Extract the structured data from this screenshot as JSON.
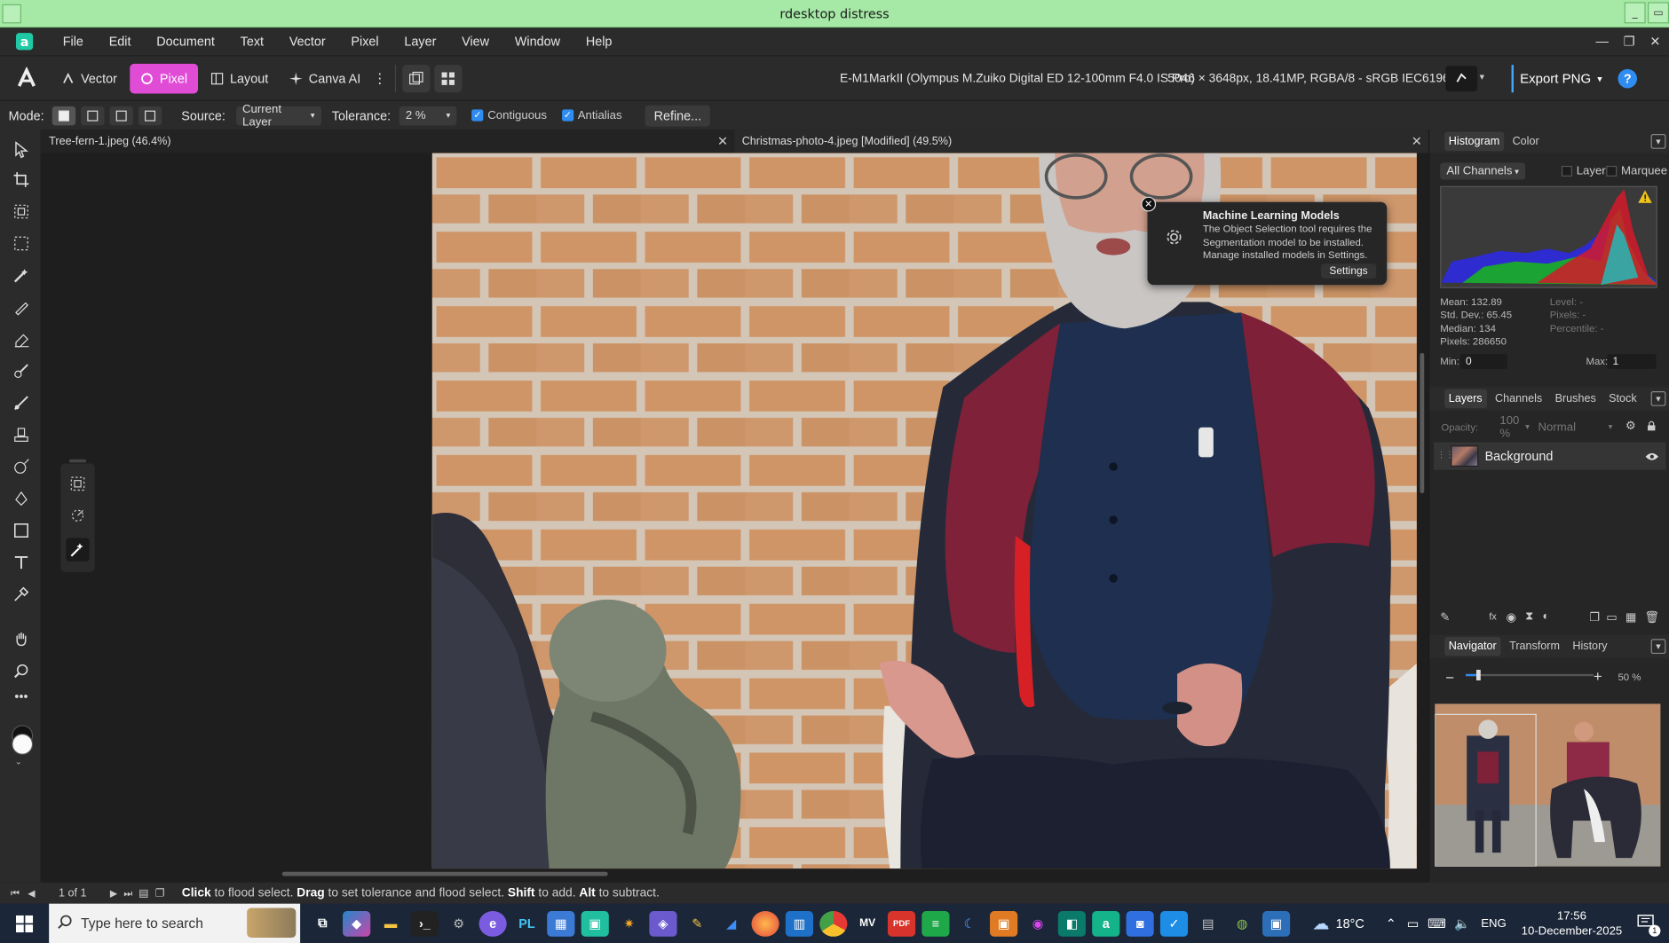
{
  "window": {
    "title": "rdesktop distress"
  },
  "menu": [
    "File",
    "Edit",
    "Document",
    "Text",
    "Vector",
    "Pixel",
    "Layer",
    "View",
    "Window",
    "Help"
  ],
  "toolbar": {
    "personas": [
      {
        "label": "Vector",
        "active": false
      },
      {
        "label": "Pixel",
        "active": true
      },
      {
        "label": "Layout",
        "active": false
      },
      {
        "label": "Canva AI",
        "active": false
      }
    ],
    "camera_info": "E-M1MarkII (Olympus M.Zuiko Digital ED 12-100mm F4.0 IS Pro)",
    "size_info": "5046 × 3648px, 18.41MP, RGBA/8 - sRGB IEC61966-2.1",
    "export_label": "Export PNG"
  },
  "context": {
    "mode_label": "Mode:",
    "source_label": "Source:",
    "source_value": "Current Layer",
    "tolerance_label": "Tolerance:",
    "tolerance_value": "2 %",
    "contiguous": "Contiguous",
    "antialias": "Antialias",
    "refine": "Refine..."
  },
  "documents": {
    "tab1": "Tree-fern-1.jpeg (46.4%)",
    "tab2": "Christmas-photo-4.jpeg [Modified] (49.5%)"
  },
  "popup": {
    "title": "Machine Learning Models",
    "body": "The Object Selection tool requires the Segmentation model to be installed. Manage installed models in Settings.",
    "button": "Settings"
  },
  "histogram": {
    "tabs": [
      "Histogram",
      "Color"
    ],
    "channel": "All Channels",
    "layer_label": "Layer",
    "marquee_label": "Marquee",
    "mean": "Mean: 132.89",
    "stddev": "Std. Dev.: 65.45",
    "median": "Median: 134",
    "pixels": "Pixels: 286650",
    "level": "Level: -",
    "pixels_r": "Pixels: -",
    "percentile": "Percentile: -",
    "min_label": "Min:",
    "min_value": "0",
    "max_label": "Max:",
    "max_value": "1"
  },
  "layers": {
    "tabs": [
      "Layers",
      "Channels",
      "Brushes",
      "Stock"
    ],
    "opacity_label": "Opacity:",
    "opacity_value": "100 %",
    "blend_mode": "Normal",
    "layer_name": "Background"
  },
  "navigator": {
    "tabs": [
      "Navigator",
      "Transform",
      "History"
    ],
    "zoom": "50 %",
    "zoom_fraction": 0.08
  },
  "status": {
    "page": "1 of 1",
    "hint_click": "Click",
    "hint_1": " to flood select. ",
    "hint_drag": "Drag",
    "hint_2": " to set tolerance and flood select. ",
    "hint_shift": "Shift",
    "hint_3": " to add. ",
    "hint_alt": "Alt",
    "hint_4": " to subtract."
  },
  "taskbar": {
    "search_placeholder": "Type here to search",
    "weather": "18°C",
    "lang": "ENG",
    "time": "17:56",
    "date": "10-December-2025",
    "notif_count": "1"
  },
  "colors": {
    "accent_pixel": "#e14cd7",
    "accent_blue": "#2f8cf0",
    "titlebar": "#a6e9a6"
  }
}
